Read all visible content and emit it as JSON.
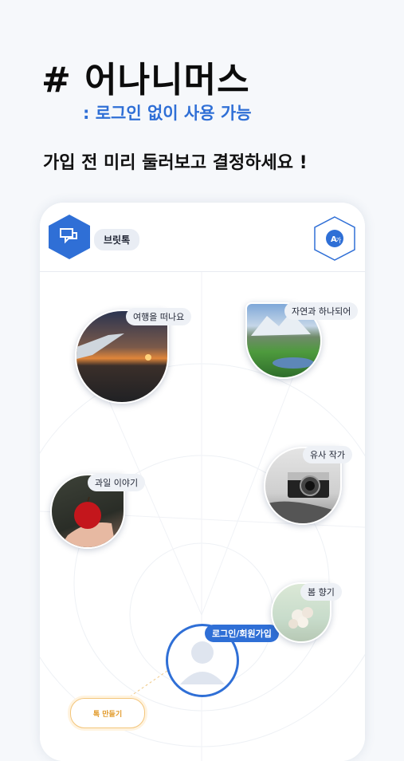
{
  "headline": "# 어나니머스",
  "subheadline": ": 로그인 없이 사용 가능",
  "lead": "가입 전 미리 둘러보고 결정하세요 !",
  "app": {
    "name_chip": "브릿톡",
    "chat_icon": "chat-bubbles-icon",
    "translate_icon": "translate-icon"
  },
  "bubbles": [
    {
      "label": "여행을 떠나요",
      "image": "airplane-window-sunset"
    },
    {
      "label": "자연과 하나되어",
      "image": "mountain-lake"
    },
    {
      "label": "유사 작가",
      "image": "vintage-camera"
    },
    {
      "label": "과일 이야기",
      "image": "apple-in-hand"
    },
    {
      "label": "봄 향기",
      "image": "flower-bouquet"
    }
  ],
  "login_label": "로그인/회원가입",
  "make_button": "톡 만들기",
  "colors": {
    "accent": "#2f6fd6",
    "orange": "#e29a2a"
  }
}
